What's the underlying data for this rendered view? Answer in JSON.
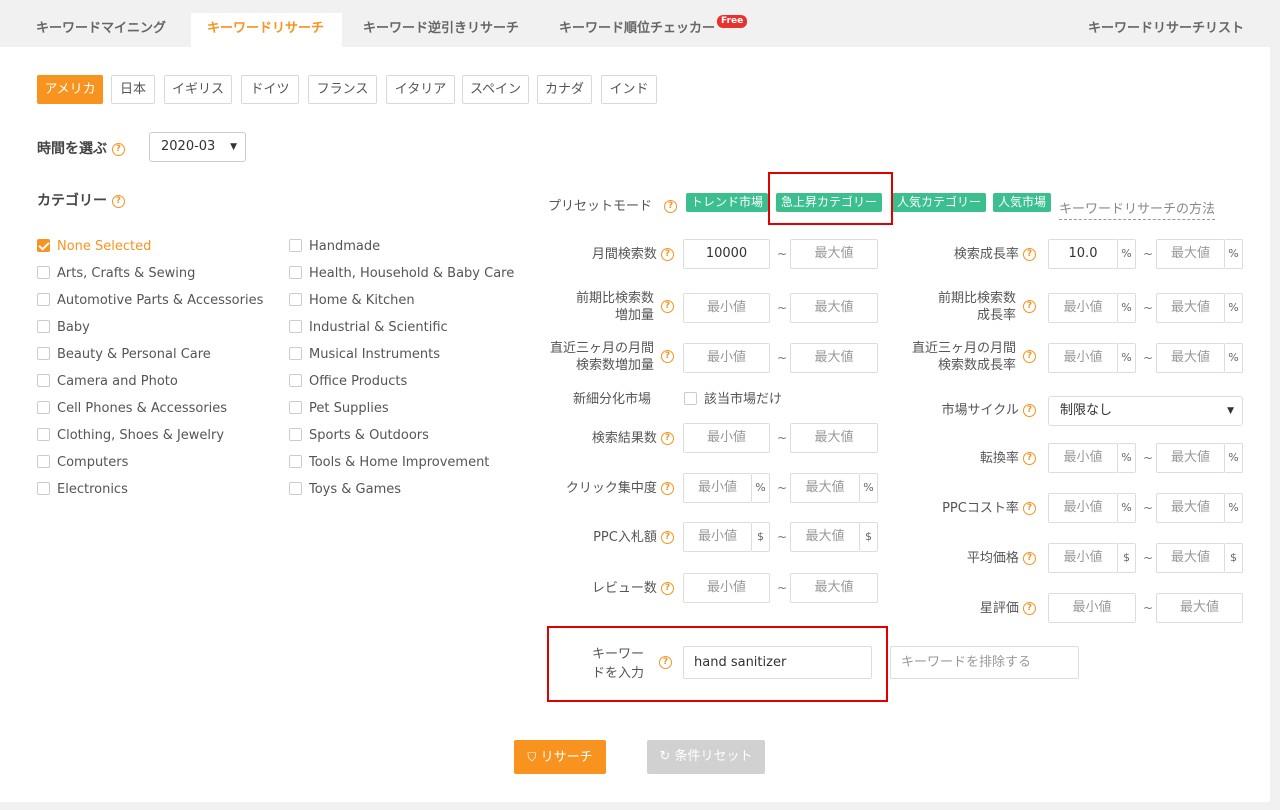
{
  "tabs": [
    {
      "label": "キーワードマイニング"
    },
    {
      "label": "キーワードリサーチ"
    },
    {
      "label": "キーワード逆引きリサーチ"
    },
    {
      "label": "キーワード順位チェッカー",
      "badge": "Free"
    },
    {
      "label": "キーワードリサーチリスト"
    }
  ],
  "countries": [
    "アメリカ",
    "日本",
    "イギリス",
    "ドイツ",
    "フランス",
    "イタリア",
    "スペイン",
    "カナダ",
    "インド"
  ],
  "time": {
    "label": "時間を選ぶ",
    "value": "2020-03"
  },
  "category": {
    "label": "カテゴリー",
    "col1": [
      "None Selected",
      "Arts, Crafts & Sewing",
      "Automotive Parts & Accessories",
      "Baby",
      "Beauty & Personal Care",
      "Camera and Photo",
      "Cell Phones & Accessories",
      "Clothing, Shoes & Jewelry",
      "Computers",
      "Electronics"
    ],
    "col2": [
      "Handmade",
      "Health, Household & Baby Care",
      "Home & Kitchen",
      "Industrial & Scientific",
      "Musical Instruments",
      "Office Products",
      "Pet Supplies",
      "Sports & Outdoors",
      "Tools & Home Improvement",
      "Toys & Games"
    ]
  },
  "preset": {
    "label": "プリセットモード",
    "tags": [
      "トレンド市場",
      "急上昇カテゴリー",
      "人気カテゴリー",
      "人気市場"
    ],
    "howto": "キーワードリサーチの方法"
  },
  "fields": {
    "min": "最小値",
    "max": "最大値",
    "tilde": "~",
    "monthly_search": {
      "label": "月間検索数",
      "min_value": "10000"
    },
    "search_growth": {
      "label": "検索成長率",
      "min_value": "10.0"
    },
    "prev_increase": {
      "label1": "前期比検索数",
      "label2": "増加量"
    },
    "prev_growth": {
      "label1": "前期比検索数",
      "label2": "成長率"
    },
    "three_increase": {
      "label1": "直近三ヶ月の月間",
      "label2": "検索数増加量"
    },
    "three_growth": {
      "label1": "直近三ヶ月の月間",
      "label2": "検索数成長率"
    },
    "niche": {
      "label": "新細分化市場",
      "check": "該当市場だけ"
    },
    "cycle": {
      "label": "市場サイクル",
      "value": "制限なし"
    },
    "results": {
      "label": "検索結果数"
    },
    "conversion": {
      "label": "転換率"
    },
    "click": {
      "label": "クリック集中度"
    },
    "ppc_cost": {
      "label": "PPCコスト率"
    },
    "ppc_bid": {
      "label": "PPC入札額"
    },
    "avg_price": {
      "label": "平均価格"
    },
    "reviews": {
      "label": "レビュー数"
    },
    "rating": {
      "label": "星評価"
    },
    "keyword": {
      "label1": "キーワー",
      "label2": "ドを入力",
      "value": "hand sanitizer",
      "exclude_placeholder": "キーワードを排除する"
    }
  },
  "units": {
    "pct": "%",
    "usd": "$"
  },
  "buttons": {
    "search": "リサーチ",
    "reset": "条件リセット"
  },
  "colors": {
    "accent": "#f7931e",
    "tag": "#3cbf8e",
    "highlight": "#e00000"
  }
}
